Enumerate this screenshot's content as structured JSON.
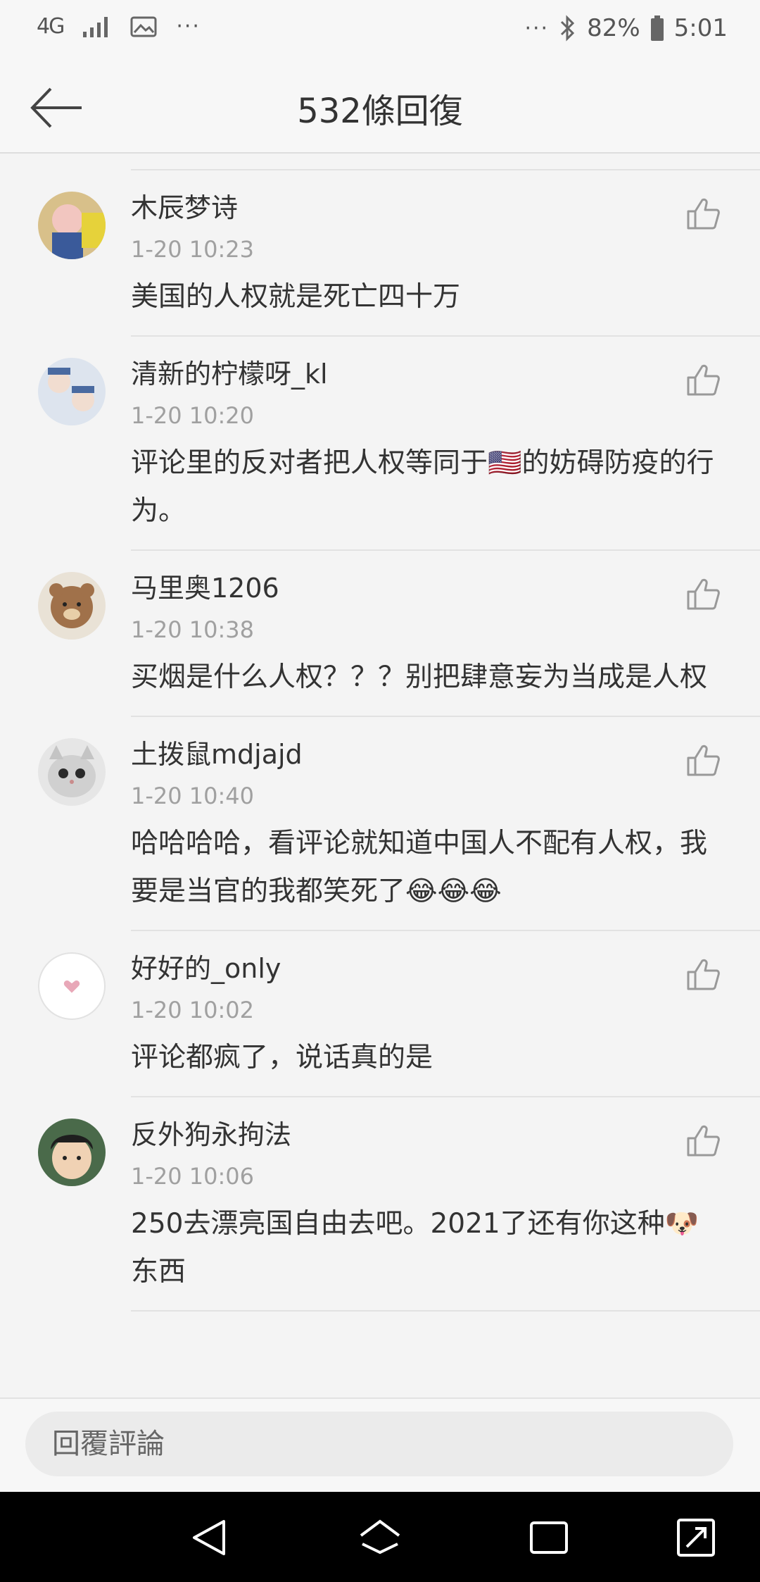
{
  "status_bar": {
    "network": "4G",
    "battery": "82%",
    "time": "5:01"
  },
  "header": {
    "title": "532條回復"
  },
  "comments": [
    {
      "user": "木辰梦诗",
      "time": "1-20 10:23",
      "text": "美国的人权就是死亡四十万"
    },
    {
      "user": "清新的柠檬呀_kl",
      "time": "1-20 10:20",
      "text": "评论里的反对者把人权等同于🇺🇸的妨碍防疫的行为。"
    },
    {
      "user": "马里奥1206",
      "time": "1-20 10:38",
      "text": "买烟是什么人权？？？别把肆意妄为当成是人权"
    },
    {
      "user": "土拨鼠mdjajd",
      "time": "1-20 10:40",
      "text": "哈哈哈哈，看评论就知道中国人不配有人权，我要是当官的我都笑死了😂😂😂"
    },
    {
      "user": "好好的_only",
      "time": "1-20 10:02",
      "text": "评论都疯了，说话真的是"
    },
    {
      "user": "反外狗永拘法",
      "time": "1-20 10:06",
      "text": "250去漂亮国自由去吧。2021了还有你这种🐶东西"
    }
  ],
  "reply": {
    "placeholder": "回覆評論"
  },
  "icons": {
    "back": "back-arrow-icon",
    "like": "thumbs-up-icon",
    "nav_back": "nav-back-icon",
    "nav_home": "nav-home-icon",
    "nav_recent": "nav-recent-icon",
    "nav_expand": "nav-expand-icon"
  }
}
